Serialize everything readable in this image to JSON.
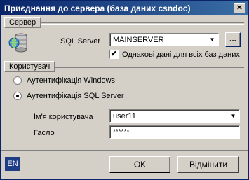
{
  "window": {
    "title": "Приєднання до сервера (база даних csndoc)",
    "close_glyph": "✕"
  },
  "server_group": {
    "label": "Сервер",
    "sql_server_label": "SQL Server",
    "sql_server_value": "MAINSERVER",
    "browse_label": "...",
    "same_data_checked": true,
    "same_data_label": "Однакові дані для всіх баз даних"
  },
  "user_group": {
    "label": "Користувач",
    "auth_windows_label": "Аутентифікація Windows",
    "auth_sql_label": "Аутентифікація SQL Server",
    "selected_auth": "sql",
    "username_label": "Ім'я користувача",
    "username_value": "user11",
    "password_label": "Гасло",
    "password_value": "******"
  },
  "footer": {
    "language_badge": "EN",
    "ok_label": "OK",
    "cancel_label": "Відмінити"
  }
}
